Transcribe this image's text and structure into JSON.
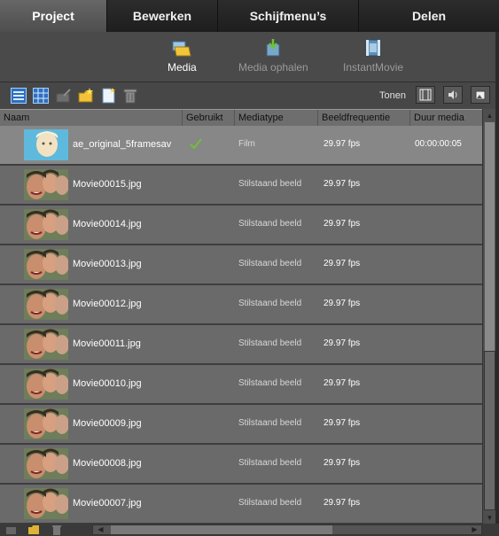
{
  "tabs": [
    "Project",
    "Bewerken",
    "Schijfmenu’s",
    "Delen"
  ],
  "subnav": {
    "media": "Media",
    "media_ophalen": "Media ophalen",
    "instantmovie": "InstantMovie"
  },
  "toolbar": {
    "tonen_label": "Tonen"
  },
  "columns": {
    "naam": "Naam",
    "gebruikt": "Gebruikt",
    "mediatype": "Mediatype",
    "beeldfrequentie": "Beeldfrequentie",
    "duur": "Duur media"
  },
  "rows": [
    {
      "name": "ae_original_5framesav",
      "used": true,
      "type": "Film",
      "fps": "29.97 fps",
      "duration": "00:00:00:05"
    },
    {
      "name": "Movie00015.jpg",
      "used": false,
      "type": "Stilstaand beeld",
      "fps": "29.97 fps",
      "duration": ""
    },
    {
      "name": "Movie00014.jpg",
      "used": false,
      "type": "Stilstaand beeld",
      "fps": "29.97 fps",
      "duration": ""
    },
    {
      "name": "Movie00013.jpg",
      "used": false,
      "type": "Stilstaand beeld",
      "fps": "29.97 fps",
      "duration": ""
    },
    {
      "name": "Movie00012.jpg",
      "used": false,
      "type": "Stilstaand beeld",
      "fps": "29.97 fps",
      "duration": ""
    },
    {
      "name": "Movie00011.jpg",
      "used": false,
      "type": "Stilstaand beeld",
      "fps": "29.97 fps",
      "duration": ""
    },
    {
      "name": "Movie00010.jpg",
      "used": false,
      "type": "Stilstaand beeld",
      "fps": "29.97 fps",
      "duration": ""
    },
    {
      "name": "Movie00009.jpg",
      "used": false,
      "type": "Stilstaand beeld",
      "fps": "29.97 fps",
      "duration": ""
    },
    {
      "name": "Movie00008.jpg",
      "used": false,
      "type": "Stilstaand beeld",
      "fps": "29.97 fps",
      "duration": ""
    },
    {
      "name": "Movie00007.jpg",
      "used": false,
      "type": "Stilstaand beeld",
      "fps": "29.97 fps",
      "duration": ""
    }
  ],
  "colors": {
    "used_check": "#6fbf3a",
    "tab_active": "#5a5a5a"
  }
}
